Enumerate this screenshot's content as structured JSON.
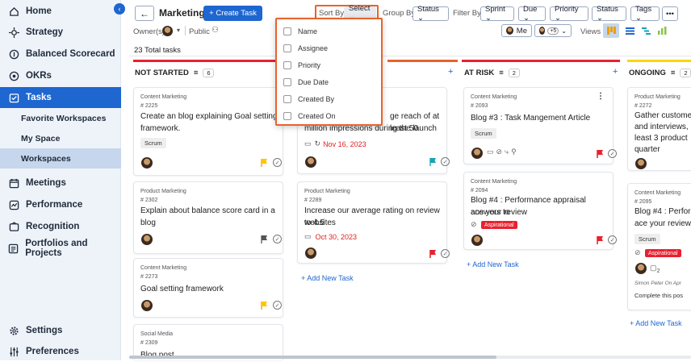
{
  "sidebar": {
    "collapse_glyph": "‹",
    "items": [
      {
        "label": "Home",
        "icon": "home-icon"
      },
      {
        "label": "Strategy",
        "icon": "strategy-icon"
      },
      {
        "label": "Balanced Scorecard",
        "icon": "scorecard-icon"
      },
      {
        "label": "OKRs",
        "icon": "target-icon"
      },
      {
        "label": "Tasks",
        "icon": "tasks-icon"
      },
      {
        "label": "Meetings",
        "icon": "calendar-icon"
      },
      {
        "label": "Performance",
        "icon": "performance-icon"
      },
      {
        "label": "Recognition",
        "icon": "recognition-icon"
      },
      {
        "label": "Portfolios and Projects",
        "icon": "portfolio-icon"
      },
      {
        "label": "Settings",
        "icon": "gear-icon"
      },
      {
        "label": "Preferences",
        "icon": "sliders-icon"
      }
    ],
    "subitems": [
      "Favorite Workspaces",
      "My Space",
      "Workspaces"
    ]
  },
  "toolbar": {
    "back": "←",
    "workspace": "Marketing ▾",
    "create": "+ Create Task",
    "sort_label": "Sort By",
    "sort_value": "Select ⌄",
    "group_label": "Group By",
    "group_value": "Status ⌄",
    "filter_label": "Filter By",
    "filters": [
      "Sprint ⌄",
      "Due ⌄",
      "Priority ⌄",
      "Status ⌄",
      "Tags ⌄",
      "•••"
    ],
    "owner_label": "Owner(s)",
    "public_label": "Public",
    "me_label": "Me",
    "plus_count": "+5",
    "views_label": "Views",
    "total": "23  Total tasks"
  },
  "sort_options": [
    "Name",
    "Assignee",
    "Priority",
    "Due Date",
    "Created By",
    "Created On"
  ],
  "columns": [
    {
      "title": "NOT STARTED",
      "count": "6",
      "color": "#e8212f"
    },
    {
      "title": "AT RISK",
      "count": "2",
      "color": "#e8212f"
    },
    {
      "title": "ONGOING",
      "count": "2",
      "color": "#ffd400"
    }
  ],
  "accent_colors": {
    "primary": "#1e66d0",
    "orange": "#e8632b",
    "red": "#e8212f",
    "yellow": "#ffd400",
    "teal": "#17a2b8",
    "green": "#8bc34a"
  },
  "cards": {
    "ns1": {
      "category": "Content Marketing",
      "id": "# 2225",
      "title_l1": "Create an blog explaining Goal setting",
      "title_l2": "framework.",
      "tag": "Scrum"
    },
    "ns2": {
      "category": "Product Marketing",
      "id": "# 2302",
      "title_l1": "Explain about balance score card in a blog"
    },
    "ns3": {
      "category": "Content Marketing",
      "id": "# 2273",
      "title_l1": "Goal setting framework"
    },
    "ns4": {
      "category": "Social Media",
      "id": "# 2309",
      "title_l1": "Blog post"
    },
    "c2a": {
      "title_l1": "ge reach of at least 50",
      "title_l2": "million impressions during the launch",
      "date": "Nov 16, 2023"
    },
    "c2b": {
      "category": "Product Marketing",
      "id": "# 2289",
      "title_l1": "Increase our average rating on review websites",
      "title_l2": "to 4.5",
      "date": "Oct 30, 2023"
    },
    "ar1": {
      "category": "Content Marketing",
      "id": "# 2093",
      "title_l1": "Blog #3 : Task Mangement Article",
      "tag": "Scrum"
    },
    "ar2": {
      "category": "Content Marketing",
      "id": "# 2094",
      "title_l1": "Blog #4 : Performance appraisal answers to",
      "title_l2": "ace your review",
      "badge": "Aspirational"
    },
    "og1": {
      "category": "Product Marketing",
      "id": "# 2272",
      "title_l1": "Gather custome",
      "title_l2": "and interviews,",
      "title_l3": "least 3 product",
      "title_l4": "quarter"
    },
    "og2": {
      "category": "Content Marketing",
      "id": "# 2095",
      "title_l1": "Blog #4 : Perfor",
      "title_l2": "ace your review",
      "tag": "Scrum",
      "badge": "Aspirational",
      "comments": "2",
      "author": "Simon Peter On Apr",
      "note": "Complete this pos"
    }
  },
  "add_task": "+ Add New Task"
}
